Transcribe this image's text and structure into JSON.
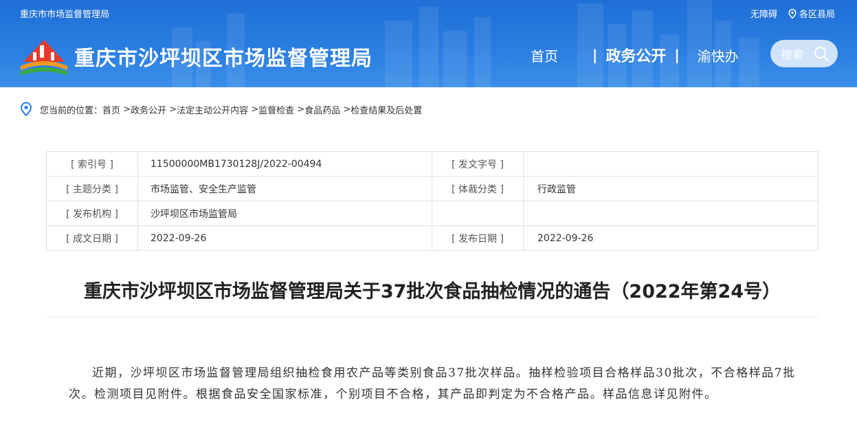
{
  "header": {
    "top_title": "重庆市市场监督管理局",
    "accessibility": "无障碍",
    "districts": "各区县局",
    "site_title": "重庆市沙坪坝区市场监督管理局",
    "nav": [
      {
        "label": "首页",
        "active": false
      },
      {
        "label": "政务公开",
        "active": true
      },
      {
        "label": "渝快办",
        "active": false
      }
    ],
    "search_label": "搜索"
  },
  "breadcrumb": {
    "prefix": "您当前的位置：",
    "items": [
      "首页",
      "政务公开",
      "法定主动公开内容",
      "监督检查",
      "食品药品",
      "检查结果及后处置"
    ]
  },
  "info": {
    "index_label": "[ 索引号 ]",
    "index_value": "11500000MB1730128J/2022-00494",
    "doc_no_label": "[ 发文字号 ]",
    "doc_no_value": "",
    "topic_label": "[ 主题分类 ]",
    "topic_value": "市场监管、安全生产监管",
    "genre_label": "[ 体裁分类 ]",
    "genre_value": "行政监管",
    "org_label": "[ 发布机构 ]",
    "org_value": "沙坪坝区市场监管局",
    "created_label": "[ 成文日期 ]",
    "created_value": "2022-09-26",
    "published_label": "[ 发布日期 ]",
    "published_value": "2022-09-26"
  },
  "article": {
    "title": "重庆市沙坪坝区市场监督管理局关于37批次食品抽检情况的通告（2022年第24号）",
    "body": "近期，沙坪坝区市场监督管理局组织抽检食用农产品等类别食品37批次样品。抽样检验项目合格样品30批次，不合格样品7批次。检测项目见附件。根据食品安全国家标准，个别项目不合格，其产品即判定为不合格产品。样品信息详见附件。"
  },
  "colors": {
    "header_blue": "#2a7de1",
    "logo_red": "#e8392b",
    "logo_orange": "#f29a1f",
    "logo_green": "#3aa845"
  }
}
